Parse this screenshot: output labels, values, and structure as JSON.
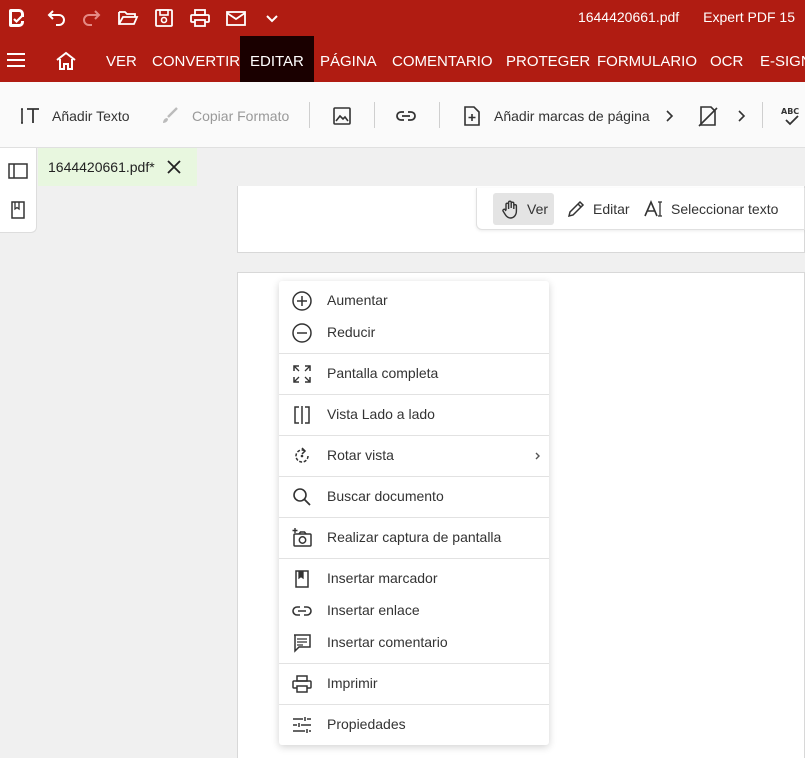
{
  "titlebar": {
    "filename": "1644420661.pdf",
    "app_name": "Expert PDF 15",
    "icons": [
      "app-logo-icon",
      "undo-icon",
      "redo-icon",
      "open-folder-icon",
      "save-icon",
      "print-icon",
      "mail-icon",
      "chevron-down-icon"
    ]
  },
  "menubar": {
    "tabs": [
      {
        "label": "VER"
      },
      {
        "label": "CONVERTIR"
      },
      {
        "label": "EDITAR"
      },
      {
        "label": "PÁGINA"
      },
      {
        "label": "COMENTARIO"
      },
      {
        "label": "PROTEGER"
      },
      {
        "label": "FORMULARIO"
      },
      {
        "label": "OCR"
      },
      {
        "label": "E-SIGN"
      }
    ],
    "active_tab": "EDITAR"
  },
  "toolbar": {
    "add_text": "Añadir Texto",
    "copy_format": "Copiar Formato",
    "add_bookmarks": "Añadir marcas de página"
  },
  "doc_tab": {
    "filename": "1644420661.pdf*"
  },
  "mode_bar": {
    "view": "Ver",
    "edit": "Editar",
    "select_text": "Seleccionar texto",
    "active": "Ver"
  },
  "context_menu": {
    "items": [
      {
        "label": "Aumentar",
        "icon": "zoom-in-icon"
      },
      {
        "label": "Reducir",
        "icon": "zoom-out-icon"
      },
      {
        "label": "Pantalla completa",
        "icon": "fullscreen-icon"
      },
      {
        "label": "Vista Lado a lado",
        "icon": "side-by-side-icon"
      },
      {
        "label": "Rotar vista",
        "icon": "rotate-icon"
      },
      {
        "label": "Buscar documento",
        "icon": "search-icon"
      },
      {
        "label": "Realizar captura de pantalla",
        "icon": "screenshot-icon"
      },
      {
        "label": "Insertar marcador",
        "icon": "bookmark-icon"
      },
      {
        "label": "Insertar enlace",
        "icon": "link-icon"
      },
      {
        "label": "Insertar comentario",
        "icon": "comment-icon"
      },
      {
        "label": "Imprimir",
        "icon": "print-icon"
      },
      {
        "label": "Propiedades",
        "icon": "properties-icon"
      }
    ]
  },
  "colors": {
    "brand": "#b01c12",
    "active_tab": "#1a0000",
    "doc_tab_bg": "#e8f7df"
  }
}
